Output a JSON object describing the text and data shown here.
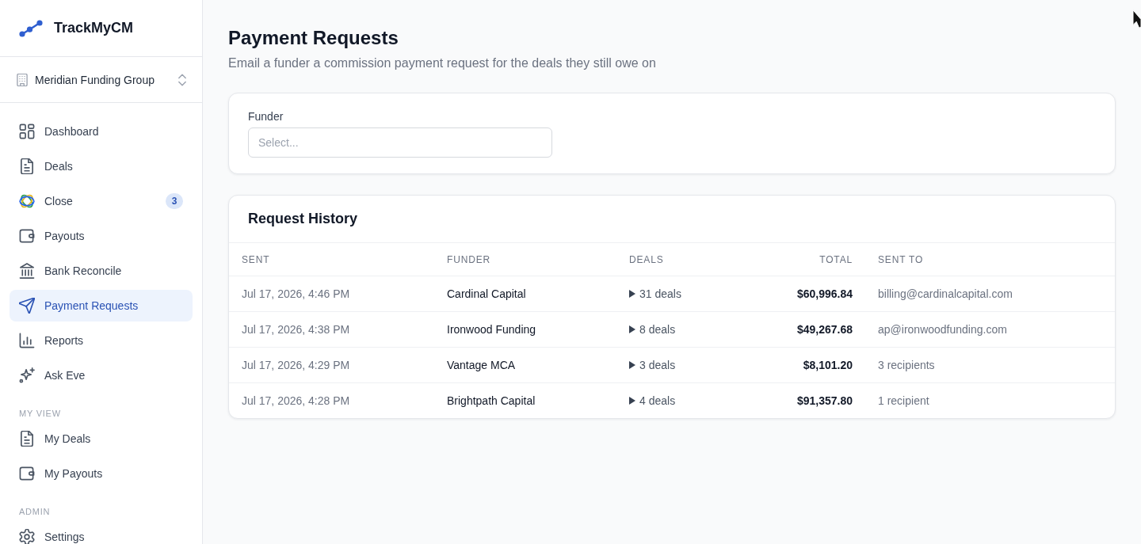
{
  "sidebar": {
    "brand": "TrackMyCM",
    "organization": "Meridian Funding Group",
    "sections": [
      {
        "items": [
          {
            "label": "Dashboard",
            "selected": false
          },
          {
            "label": "Deals",
            "selected": false
          },
          {
            "label": "Close",
            "selected": false,
            "badge": "3"
          },
          {
            "label": "Payouts",
            "selected": false
          },
          {
            "label": "Bank Reconcile",
            "selected": false
          },
          {
            "label": "Payment Requests",
            "selected": true
          },
          {
            "label": "Reports",
            "selected": false
          },
          {
            "label": "Ask Eve",
            "selected": false
          }
        ]
      },
      {
        "title": "MY VIEW",
        "items": [
          {
            "label": "My Deals",
            "selected": false
          },
          {
            "label": "My Payouts",
            "selected": false
          }
        ]
      },
      {
        "title": "ADMIN",
        "items": [
          {
            "label": "Settings",
            "selected": false
          }
        ]
      }
    ]
  },
  "page": {
    "title": "Payment Requests",
    "subtitle": "Email a funder a commission payment request for the deals they still owe on"
  },
  "request_form": {
    "funder": {
      "label": "Funder",
      "placeholder": "Select..."
    }
  },
  "request_history": {
    "title": "Request History",
    "columns": [
      "SENT",
      "FUNDER",
      "DEALS",
      "TOTAL",
      "SENT TO"
    ],
    "rows": [
      {
        "sent": "Jul 17, 2026, 4:46 PM",
        "funder": "Cardinal Capital",
        "deals": "31 deals",
        "expanded": false,
        "total": "$60,996.84",
        "sent_to": "billing@cardinalcapital.com"
      },
      {
        "sent": "Jul 17, 2026, 4:38 PM",
        "funder": "Ironwood Funding",
        "deals": "8 deals",
        "expanded": false,
        "total": "$49,267.68",
        "sent_to": "ap@ironwoodfunding.com"
      },
      {
        "sent": "Jul 17, 2026, 4:29 PM",
        "funder": "Vantage MCA",
        "deals": "3 deals",
        "expanded": false,
        "total": "$8,101.20",
        "sent_to": "3 recipients"
      },
      {
        "sent": "Jul 17, 2026, 4:28 PM",
        "funder": "Brightpath Capital",
        "deals": "4 deals",
        "expanded": false,
        "total": "$91,357.80",
        "sent_to": "1 recipient"
      }
    ]
  }
}
